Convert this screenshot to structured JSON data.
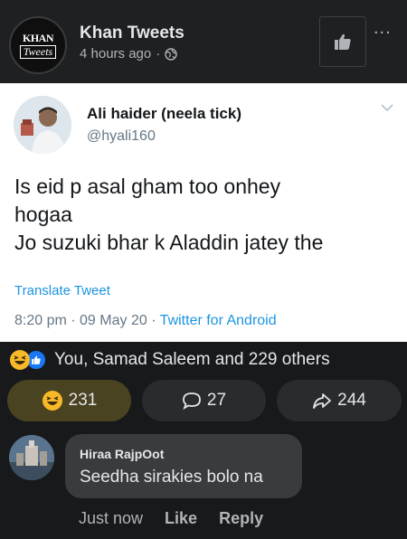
{
  "post": {
    "page_name": "Khan Tweets",
    "time_ago": "4 hours ago",
    "separator": "·",
    "logo_line1": "KHAN",
    "logo_line2": "Tweets"
  },
  "tweet": {
    "author_name": "Ali haider (neela tick)",
    "handle": "@hyali160",
    "lines": [
      "Is eid p asal gham too onhey",
      "hogaa",
      "Jo suzuki bhar k Aladdin jatey the"
    ],
    "translate_label": "Translate Tweet",
    "timestamp": "8:20 pm · 09 May 20 · ",
    "source": "Twitter for Android"
  },
  "reactions": {
    "summary": "You, Samad Saleem and 229 others"
  },
  "actions": {
    "reaction_count": "231",
    "comment_count": "27",
    "share_count": "244"
  },
  "comment": {
    "author": "Hiraa RajpOot",
    "text": "Seedha sirakies bolo na",
    "time": "Just now",
    "like_label": "Like",
    "reply_label": "Reply"
  },
  "colors": {
    "background": "#18191a",
    "tweet_link": "#1b95e0",
    "active_reaction": "#4a4321"
  }
}
